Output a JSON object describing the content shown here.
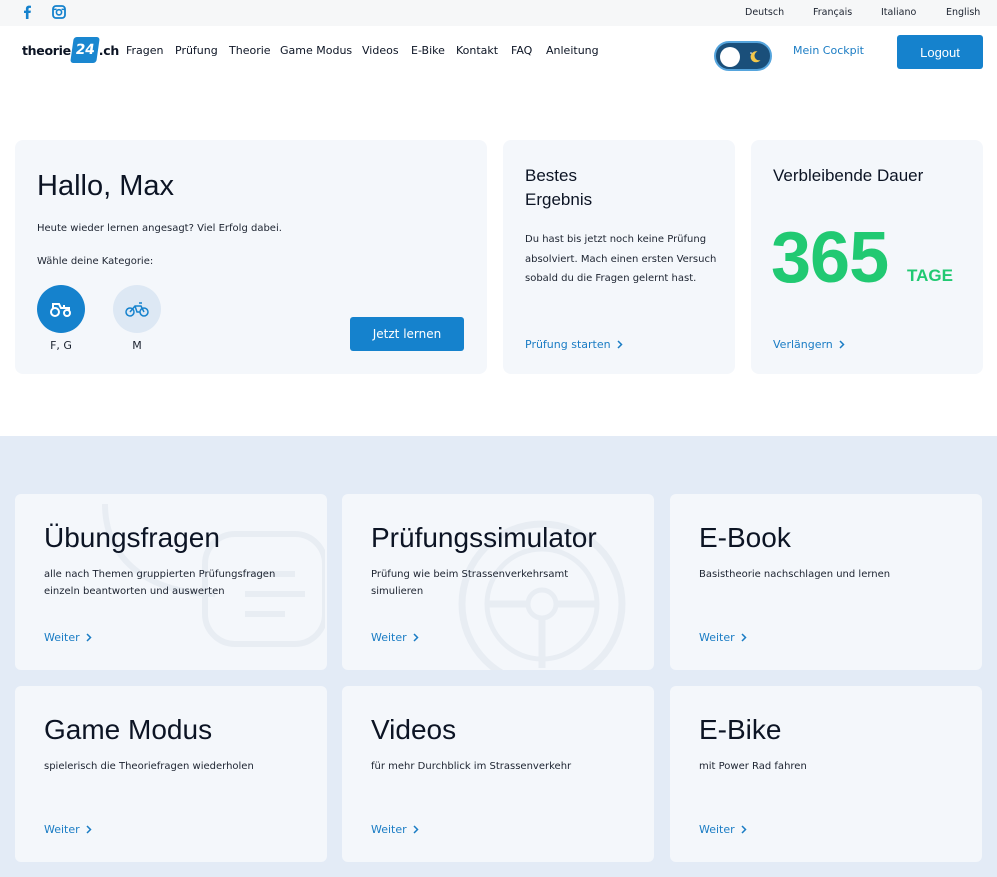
{
  "topbar": {
    "social": [
      "facebook-icon",
      "instagram-icon"
    ],
    "languages": [
      "Deutsch",
      "Français",
      "Italiano",
      "English"
    ]
  },
  "header": {
    "logo": {
      "prefix": "theorie",
      "badge": "24",
      "suffix": ".ch"
    },
    "nav": [
      "Fragen",
      "Prüfung",
      "Theorie",
      "Game Modus",
      "Videos",
      "E-Bike",
      "Kontakt",
      "FAQ",
      "Anleitung"
    ],
    "theme_toggle": {
      "state": "off",
      "icon": "moon-icon"
    },
    "cockpit": "Mein Cockpit",
    "logout": "Logout"
  },
  "hello": {
    "title": "Hallo, Max",
    "subtitle": "Heute wieder lernen angesagt? Viel Erfolg dabei.",
    "category_label": "Wähle deine Kategorie:",
    "categories": [
      {
        "name": "F, G",
        "icon": "tractor-icon",
        "active": true
      },
      {
        "name": "M",
        "icon": "moped-icon",
        "active": false
      }
    ],
    "button": "Jetzt lernen"
  },
  "best": {
    "title": "Bestes Ergebnis",
    "text": "Du hast bis jetzt noch keine Prüfung absolviert. Mach einen ersten Versuch sobald du die Fragen gelernt hast.",
    "link": "Prüfung starten"
  },
  "remaining": {
    "title": "Verbleibende Dauer",
    "value": "365",
    "unit": "TAGE",
    "link": "Verlängern"
  },
  "tiles": [
    {
      "title": "Übungsfragen",
      "text": "alle nach Themen gruppierten Prüfungsfragen einzeln beantworten und auswerten",
      "link": "Weiter"
    },
    {
      "title": "Prüfungssimulator",
      "text": "Prüfung wie beim Strassenverkehrsamt simulieren",
      "link": "Weiter"
    },
    {
      "title": "E-Book",
      "text": "Basistheorie nachschlagen und lernen",
      "link": "Weiter"
    },
    {
      "title": "Game Modus",
      "text": "spielerisch die Theoriefragen wiederholen",
      "link": "Weiter"
    },
    {
      "title": "Videos",
      "text": "für mehr Durchblick im Strassenverkehr",
      "link": "Weiter"
    },
    {
      "title": "E-Bike",
      "text": "mit Power Rad fahren",
      "link": "Weiter"
    }
  ],
  "colors": {
    "primary": "#1582cd",
    "link": "#1a7cc4",
    "accent_green": "#21c972",
    "card_bg": "#f4f7fb",
    "section_bg": "#e3ebf6"
  }
}
